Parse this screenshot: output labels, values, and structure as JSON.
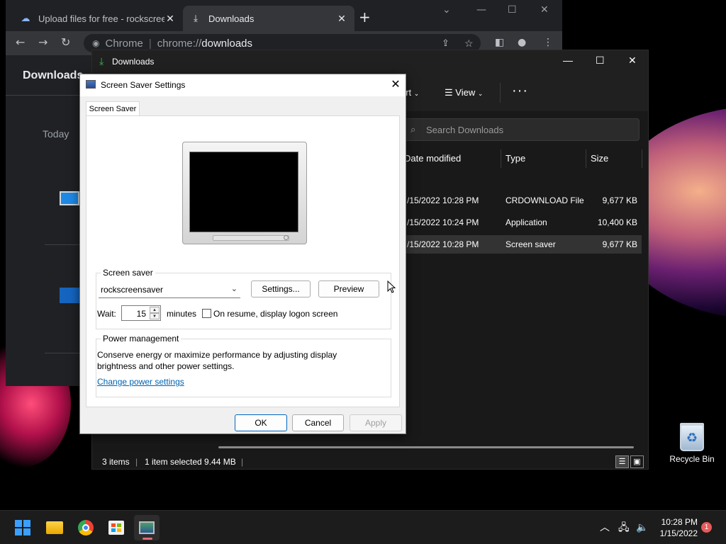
{
  "chrome": {
    "tabs": [
      {
        "title": "Upload files for free - rockscreensaver",
        "icon": "cloud-icon",
        "active": false
      },
      {
        "title": "Downloads",
        "icon": "download-icon",
        "active": true
      }
    ],
    "omnibox": {
      "site": "Chrome",
      "url_prefix": "chrome://",
      "url_path": "downloads"
    },
    "page_title": "Downloads",
    "section_today": "Today"
  },
  "explorer": {
    "title": "Downloads",
    "cmd_sort": "ort",
    "cmd_view": "View",
    "search_placeholder": "Search Downloads",
    "columns": {
      "date": "Date modified",
      "type": "Type",
      "size": "Size"
    },
    "rows": [
      {
        "date": "/15/2022 10:28 PM",
        "type": "CRDOWNLOAD File",
        "size": "9,677 KB",
        "selected": false
      },
      {
        "date": "/15/2022 10:24 PM",
        "type": "Application",
        "size": "10,400 KB",
        "selected": false
      },
      {
        "date": "/15/2022 10:28 PM",
        "type": "Screen saver",
        "size": "9,677 KB",
        "selected": true
      }
    ],
    "status": {
      "items": "3 items",
      "selected": "1 item selected  9.44 MB"
    }
  },
  "dialog": {
    "title": "Screen Saver Settings",
    "tab": "Screen Saver",
    "screensaver_group": "Screen saver",
    "screensaver_value": "rockscreensaver",
    "settings_button": "Settings...",
    "preview_button": "Preview",
    "wait_label": "Wait:",
    "wait_value": "15",
    "minutes_label": "minutes",
    "resume_label": "On resume, display logon screen",
    "power_group": "Power management",
    "power_desc": "Conserve energy or maximize performance by adjusting display brightness and other power settings.",
    "power_link": "Change power settings",
    "ok_button": "OK",
    "cancel_button": "Cancel",
    "apply_button": "Apply"
  },
  "desktop": {
    "recycle_bin": "Recycle Bin"
  },
  "taskbar": {
    "time": "10:28 PM",
    "date": "1/15/2022",
    "notifications": "1"
  }
}
